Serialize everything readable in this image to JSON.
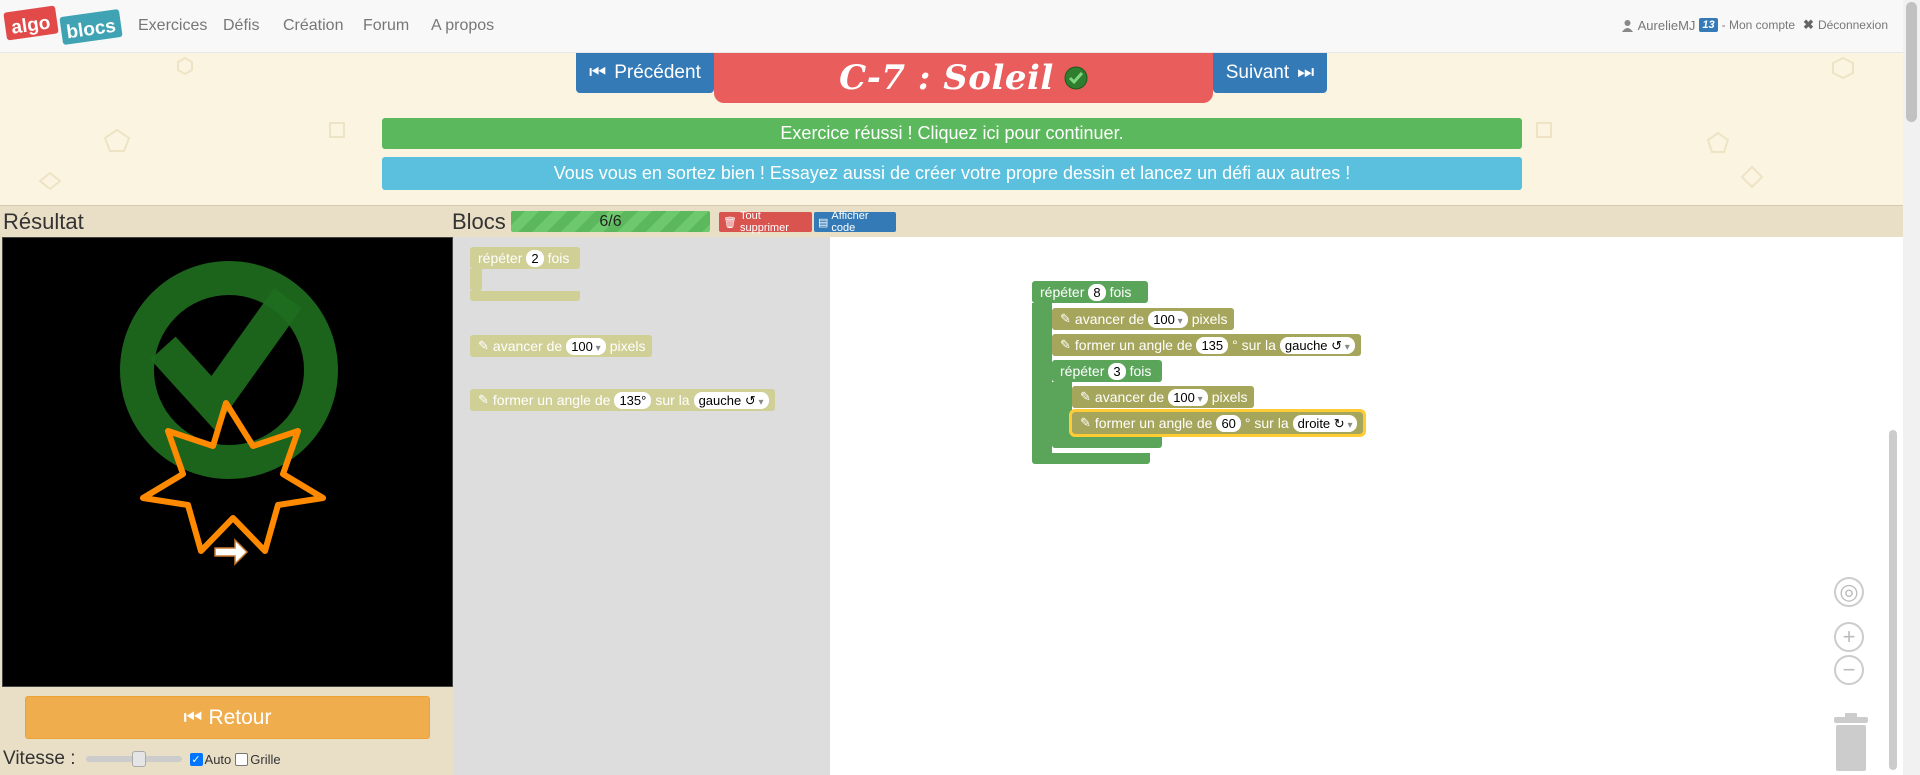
{
  "nav": {
    "logo_text_1": "algo",
    "logo_text_2": "blocs",
    "links": [
      "Exercices",
      "Défis",
      "Création",
      "Forum",
      "A propos"
    ],
    "user": "AurelieMJ",
    "badge": "13",
    "account": "- Mon compte",
    "logout": "Déconnexion"
  },
  "header": {
    "prev": "Précédent",
    "next": "Suivant",
    "title": "C-7 : Soleil",
    "success_msg": "Exercice réussi ! Cliquez ici pour continuer.",
    "info_msg": "Vous vous en sortez bien ! Essayez aussi de créer votre propre dessin et lancez un défi aux autres !"
  },
  "panels": {
    "result_label": "Résultat",
    "blocks_label": "Blocs",
    "progress": "6/6",
    "delete_all": "Tout supprimer",
    "show_code": "Afficher code"
  },
  "controls": {
    "retour": "Retour",
    "speed_label": "Vitesse :",
    "speed_value": 0.5,
    "auto_label": "Auto",
    "auto_checked": true,
    "grid_label": "Grille",
    "grid_checked": false
  },
  "toolbox": {
    "repeat": {
      "prefix": "répéter",
      "value": "2",
      "suffix": "fois"
    },
    "move": {
      "prefix": "avancer de",
      "value": "100",
      "suffix": "pixels"
    },
    "turn": {
      "prefix": "former un angle de",
      "value": "135°",
      "mid": "sur la",
      "dir": "gauche ↺"
    }
  },
  "workspace": {
    "outer_repeat": {
      "prefix": "répéter",
      "value": "8",
      "suffix": "fois"
    },
    "move1": {
      "prefix": "avancer de",
      "value": "100",
      "suffix": "pixels"
    },
    "turn1": {
      "prefix": "former un angle de",
      "value": "135",
      "mid": "° sur la",
      "dir": "gauche ↺"
    },
    "inner_repeat": {
      "prefix": "répéter",
      "value": "3",
      "suffix": "fois"
    },
    "move2": {
      "prefix": "avancer de",
      "value": "100",
      "suffix": "pixels"
    },
    "turn2": {
      "prefix": "former un angle de",
      "value": "60",
      "mid": "° sur la",
      "dir": "droite ↻"
    }
  },
  "colors": {
    "primary": "#337ab7",
    "title_bg": "#e95e5c",
    "success": "#5cb85c",
    "info": "#5bc0de",
    "warning": "#f0ad4e",
    "loop_block": "#5ba55b",
    "move_block": "#a5a55b",
    "drawing": "#ff8a00"
  }
}
